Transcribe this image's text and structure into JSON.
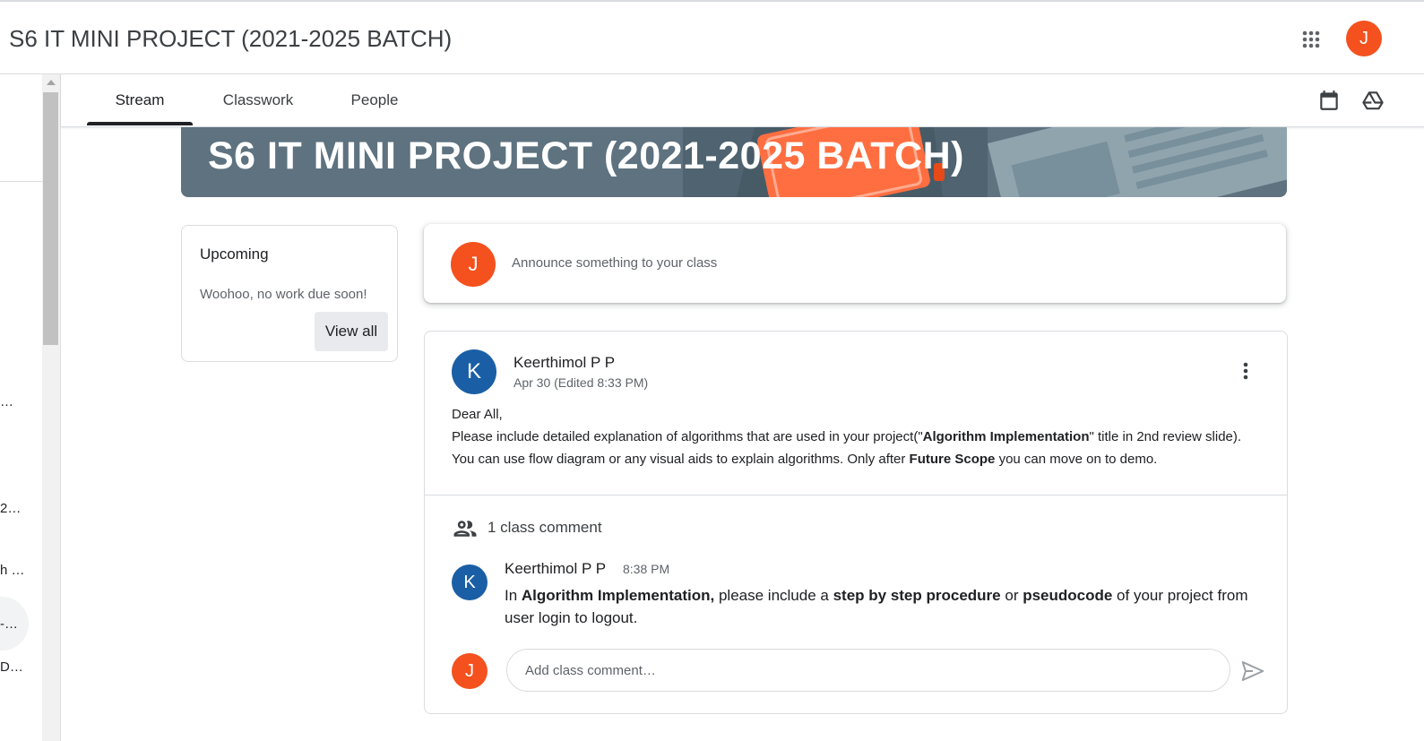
{
  "app": {
    "title": "S6 IT MINI PROJECT (2021-2025 BATCH)",
    "user_initial": "J"
  },
  "sidebar": {
    "fragments": [
      "…",
      "2…",
      "h …",
      "-…",
      "D…"
    ]
  },
  "tabs": [
    {
      "label": "Stream",
      "active": true
    },
    {
      "label": "Classwork",
      "active": false
    },
    {
      "label": "People",
      "active": false
    }
  ],
  "toolbar_icons": [
    "calendar-icon",
    "drive-icon"
  ],
  "banner": {
    "title": "S6 IT MINI PROJECT (2021-2025 BATCH)"
  },
  "upcoming": {
    "title": "Upcoming",
    "text": "Woohoo, no work due soon!",
    "view_all": "View all"
  },
  "announce": {
    "user_initial": "J",
    "placeholder": "Announce something to your class"
  },
  "post": {
    "author_initial": "K",
    "author": "Keerthimol P P",
    "date": "Apr 30 (Edited 8:33 PM)",
    "body": {
      "greeting": "Dear All,",
      "p1": "Please include detailed explanation of algorithms that are used in your project(\"",
      "b1": "Algorithm Implementation",
      "p2": "\" title in 2nd review slide). You can use flow diagram or any visual aids to explain algorithms. Only after ",
      "b2": "Future Scope",
      "p3": " you can move on to demo."
    },
    "comments_count_label": "1 class comment",
    "comment": {
      "author_initial": "K",
      "author": "Keerthimol P P",
      "time": "8:38 PM",
      "t1": "In ",
      "b1": "Algorithm Implementation,",
      "t2": " please include a ",
      "b2": "step by step procedure",
      "t3": " or ",
      "b3": "pseudocode",
      "t4": " of your project from user login to logout."
    },
    "reply": {
      "user_initial": "J",
      "placeholder": "Add class comment…"
    }
  },
  "colors": {
    "user_avatar": "#f4511e",
    "teacher_avatar": "#1a5fa5",
    "banner_bg": "#5e7280",
    "banner_accent": "#ff6e40"
  }
}
